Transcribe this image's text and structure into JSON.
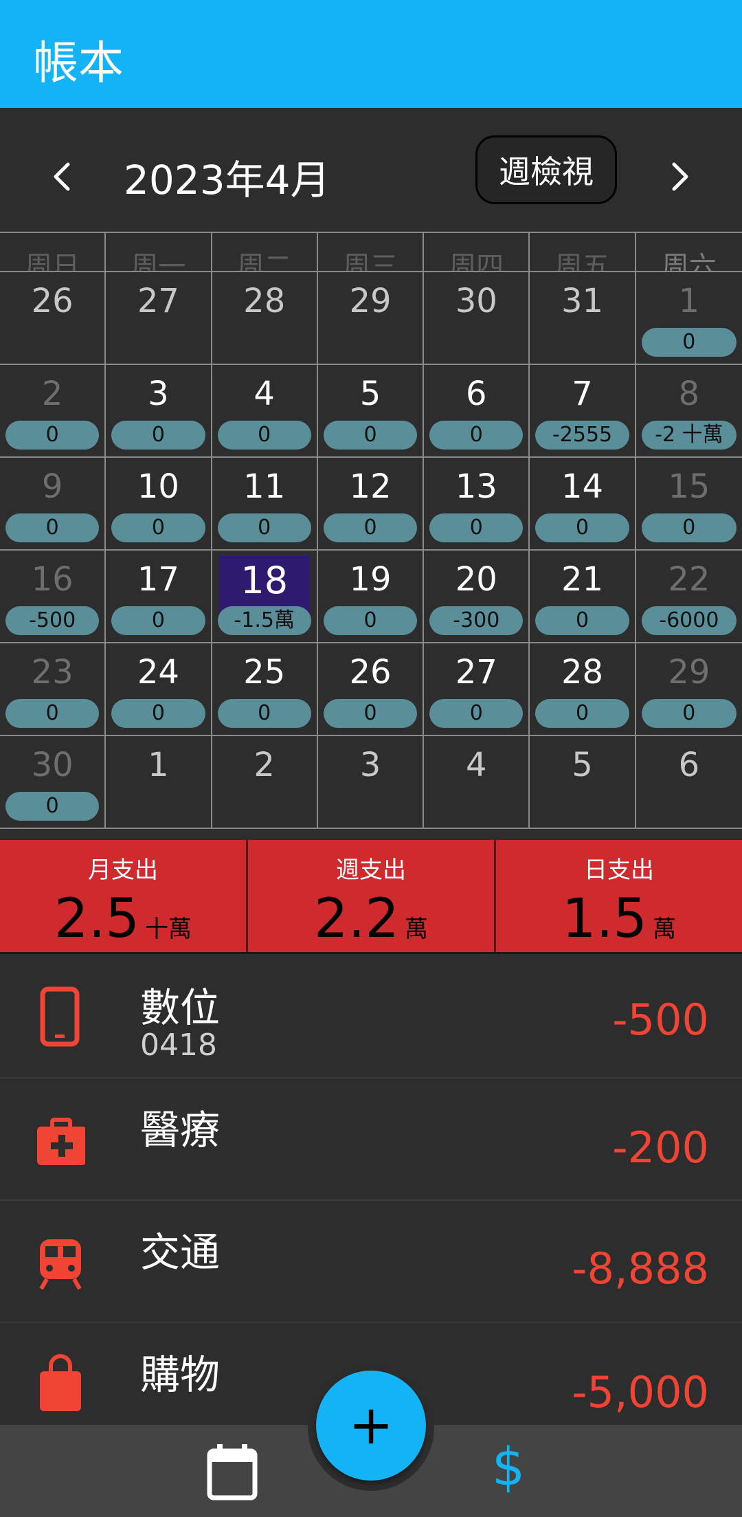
{
  "appbar": {
    "title": "帳本"
  },
  "month_nav": {
    "title": "2023年4月",
    "week_view_label": "週檢視"
  },
  "weekdays": [
    "周日",
    "周一",
    "周二",
    "周三",
    "周四",
    "周五",
    "周六"
  ],
  "calendar": {
    "days": [
      {
        "day": "26",
        "amount": "",
        "type": "outside"
      },
      {
        "day": "27",
        "amount": "",
        "type": "outside"
      },
      {
        "day": "28",
        "amount": "",
        "type": "outside"
      },
      {
        "day": "29",
        "amount": "",
        "type": "outside"
      },
      {
        "day": "30",
        "amount": "",
        "type": "outside"
      },
      {
        "day": "31",
        "amount": "",
        "type": "outside"
      },
      {
        "day": "1",
        "amount": "0",
        "type": "weekend"
      },
      {
        "day": "2",
        "amount": "0",
        "type": "weekend"
      },
      {
        "day": "3",
        "amount": "0",
        "type": "normal"
      },
      {
        "day": "4",
        "amount": "0",
        "type": "normal"
      },
      {
        "day": "5",
        "amount": "0",
        "type": "normal"
      },
      {
        "day": "6",
        "amount": "0",
        "type": "normal"
      },
      {
        "day": "7",
        "amount": "-2555",
        "type": "normal"
      },
      {
        "day": "8",
        "amount": "-2 十萬",
        "type": "weekend"
      },
      {
        "day": "9",
        "amount": "0",
        "type": "weekend"
      },
      {
        "day": "10",
        "amount": "0",
        "type": "normal"
      },
      {
        "day": "11",
        "amount": "0",
        "type": "normal"
      },
      {
        "day": "12",
        "amount": "0",
        "type": "normal"
      },
      {
        "day": "13",
        "amount": "0",
        "type": "normal"
      },
      {
        "day": "14",
        "amount": "0",
        "type": "normal"
      },
      {
        "day": "15",
        "amount": "0",
        "type": "weekend"
      },
      {
        "day": "16",
        "amount": "-500",
        "type": "weekend"
      },
      {
        "day": "17",
        "amount": "0",
        "type": "normal"
      },
      {
        "day": "18",
        "amount": "-1.5萬",
        "type": "today"
      },
      {
        "day": "19",
        "amount": "0",
        "type": "normal"
      },
      {
        "day": "20",
        "amount": "-300",
        "type": "normal"
      },
      {
        "day": "21",
        "amount": "0",
        "type": "normal"
      },
      {
        "day": "22",
        "amount": "-6000",
        "type": "weekend"
      },
      {
        "day": "23",
        "amount": "0",
        "type": "weekend"
      },
      {
        "day": "24",
        "amount": "0",
        "type": "normal"
      },
      {
        "day": "25",
        "amount": "0",
        "type": "normal"
      },
      {
        "day": "26",
        "amount": "0",
        "type": "normal"
      },
      {
        "day": "27",
        "amount": "0",
        "type": "normal"
      },
      {
        "day": "28",
        "amount": "0",
        "type": "normal"
      },
      {
        "day": "29",
        "amount": "0",
        "type": "weekend"
      },
      {
        "day": "30",
        "amount": "0",
        "type": "weekend"
      },
      {
        "day": "1",
        "amount": "",
        "type": "outside"
      },
      {
        "day": "2",
        "amount": "",
        "type": "outside"
      },
      {
        "day": "3",
        "amount": "",
        "type": "outside"
      },
      {
        "day": "4",
        "amount": "",
        "type": "outside"
      },
      {
        "day": "5",
        "amount": "",
        "type": "outside"
      },
      {
        "day": "6",
        "amount": "",
        "type": "outside"
      }
    ]
  },
  "summary": {
    "month": {
      "label": "月支出",
      "value": "2.5",
      "unit": "十萬"
    },
    "week": {
      "label": "週支出",
      "value": "2.2",
      "unit": "萬"
    },
    "day": {
      "label": "日支出",
      "value": "1.5",
      "unit": "萬"
    }
  },
  "transactions": [
    {
      "name": "數位",
      "note": "0418",
      "amount": "-500",
      "icon": "phone-icon"
    },
    {
      "name": "醫療",
      "note": "",
      "amount": "-200",
      "icon": "medical-kit-icon"
    },
    {
      "name": "交通",
      "note": "",
      "amount": "-8,888",
      "icon": "train-icon"
    },
    {
      "name": "購物",
      "note": "",
      "amount": "-5,000",
      "icon": "shopping-bag-icon"
    }
  ],
  "fab": {
    "label": "+"
  },
  "bottom_nav": {
    "money_label": "$"
  },
  "colors": {
    "appbar": "#13b3f5",
    "summary": "#cf2b2e",
    "pill": "#5a8f9a",
    "today": "#2e1a6e",
    "expense": "#f04434"
  }
}
